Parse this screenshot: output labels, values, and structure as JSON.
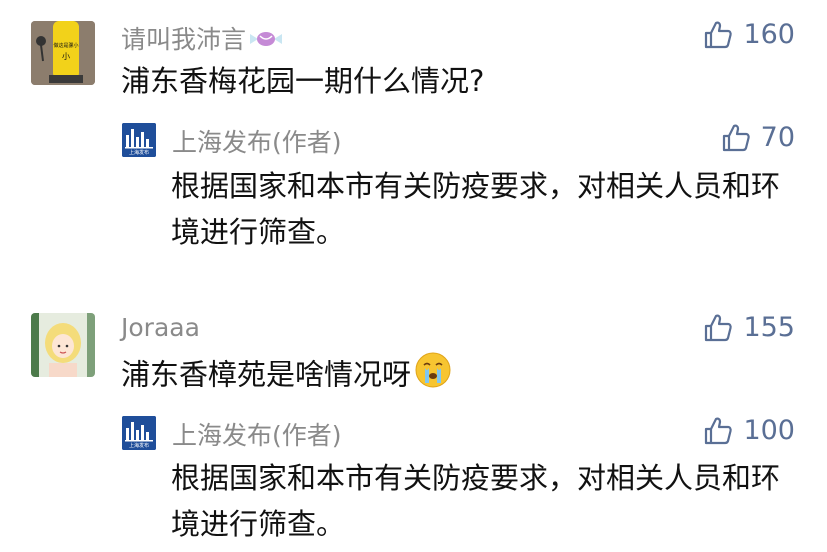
{
  "comments": [
    {
      "username": "请叫我沛言",
      "likes": "160",
      "text": "浦东香梅花园一期什么情况?",
      "avatar_text": "做这是骡小",
      "reply": {
        "author": "上海发布(作者)",
        "likes": "70",
        "text": "根据国家和本市有关防疫要求，对相关人员和环境进行筛查。",
        "avatar_text": "上海发布"
      }
    },
    {
      "username": "Joraaa",
      "likes": "155",
      "text": "浦东香樟苑是啥情况呀",
      "reply": {
        "author": "上海发布(作者)",
        "likes": "100",
        "text": "根据国家和本市有关防疫要求，对相关人员和环境进行筛查。",
        "avatar_text": "上海发布"
      }
    }
  ],
  "icons": {
    "like": "thumbs-up-icon",
    "candy": "candy-icon",
    "emoji": "crying-face-emoji"
  },
  "colors": {
    "like": "#5a6f95",
    "username": "#8a8a8a",
    "publisher_avatar": "#1f4e9a"
  }
}
